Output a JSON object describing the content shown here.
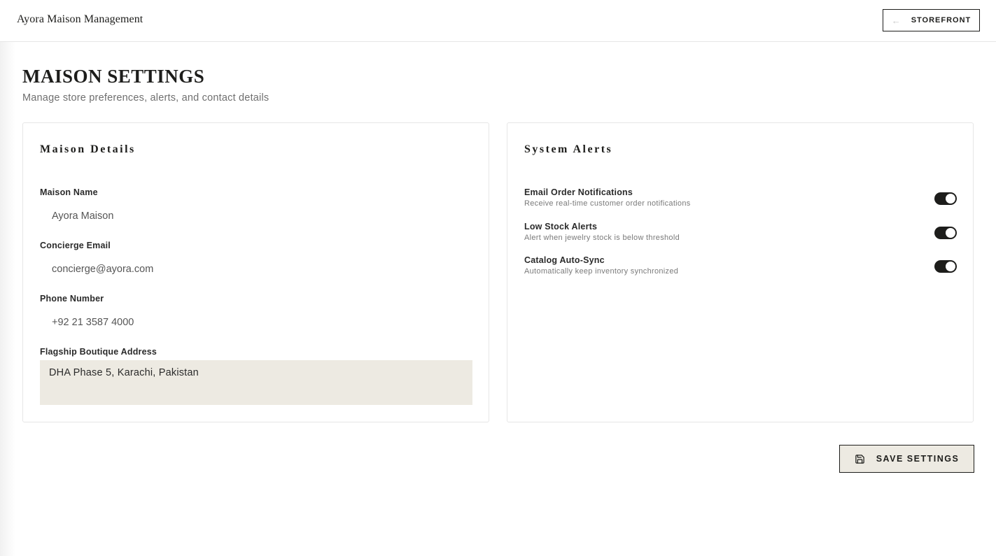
{
  "header": {
    "brand": "Ayora Maison Management",
    "storefront_label": "STOREFRONT",
    "storefront_icon": "arrow-left-icon"
  },
  "page": {
    "title": "MAISON SETTINGS",
    "subtitle": "Manage store preferences, alerts, and contact details"
  },
  "details": {
    "title": "Maison Details",
    "fields": [
      {
        "label": "Maison Name",
        "value": "Ayora Maison"
      },
      {
        "label": "Concierge Email",
        "value": "concierge@ayora.com"
      },
      {
        "label": "Phone Number",
        "value": "+92 21 3587 4000"
      },
      {
        "label": "Flagship Boutique Address",
        "value": "DHA Phase 5, Karachi, Pakistan"
      }
    ]
  },
  "alerts": {
    "title": "System Alerts",
    "items": [
      {
        "title": "Email Order Notifications",
        "description": "Receive real-time customer order notifications",
        "enabled": true
      },
      {
        "title": "Low Stock Alerts",
        "description": "Alert when jewelry stock is below threshold",
        "enabled": true
      },
      {
        "title": "Catalog Auto-Sync",
        "description": "Automatically keep inventory synchronized",
        "enabled": true
      }
    ]
  },
  "actions": {
    "save_label": "SAVE SETTINGS",
    "save_icon": "floppy-disk-icon"
  },
  "colors": {
    "accent": "#1d1d1b",
    "input_bg": "#edeae2",
    "muted_text": "#6f6f6f"
  }
}
